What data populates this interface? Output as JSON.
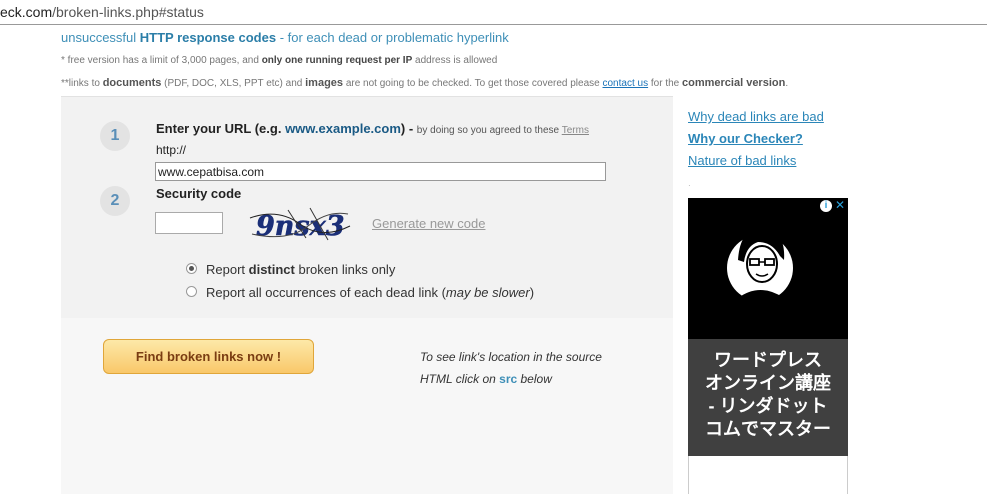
{
  "browser": {
    "url_host": "eck.com",
    "url_path": "/broken-links.php#status"
  },
  "info": {
    "line1_pre": "unsuccessful ",
    "line1_bold": "HTTP response codes",
    "line1_post": " - for each dead or problematic hyperlink",
    "line2_pre": "* free version has a limit of 3,000 pages, and ",
    "line2_bold": "only one running request per IP",
    "line2_post": " address is allowed",
    "line3_a": "**links to ",
    "line3_b": "documents",
    "line3_c": " (PDF, DOC, XLS, PPT etc) and ",
    "line3_d": "images",
    "line3_e": " are not going to be checked. To get those covered please ",
    "line3_link": "contact us",
    "line3_f": " for the ",
    "line3_g": "commercial version",
    "line3_h": "."
  },
  "form": {
    "step1": "1",
    "step2": "2",
    "url_label_pre": "Enter your URL (e.g. ",
    "url_label_example": "www.example.com",
    "url_label_post": ") - ",
    "agree_text": "by doing so you agreed to these ",
    "terms_link": "Terms",
    "http_prefix": "http://",
    "url_value": "www.cepatbisa.com",
    "security_label": "Security code",
    "security_value": "",
    "captcha_text": "9nsx3",
    "generate_link": "Generate new code",
    "radio1_pre": "Report ",
    "radio1_bold": "distinct",
    "radio1_post": " broken links only",
    "radio2_pre": "Report all occurrences of each dead link (",
    "radio2_italic": "may be slower",
    "radio2_post": ")",
    "find_button": "Find broken links now !",
    "hint_line1": "To see link's location in the source",
    "hint_pre": "HTML click on ",
    "hint_src": "src",
    "hint_post": " below"
  },
  "sidebar": {
    "links": [
      {
        "label": "Why dead links are bad"
      },
      {
        "label": "Why our Checker?"
      },
      {
        "label": "Nature of bad links"
      }
    ]
  },
  "ad": {
    "lines": [
      "ワードプレス",
      "オンライン講座",
      "- リンダドット",
      "コムでマスター"
    ],
    "choice_icon": "i",
    "close_icon": "✕"
  },
  "colors": {
    "link_blue": "#2b86b8",
    "button_top": "#fde9a8",
    "button_bottom": "#f9c86a",
    "button_text": "#7a3d12"
  }
}
